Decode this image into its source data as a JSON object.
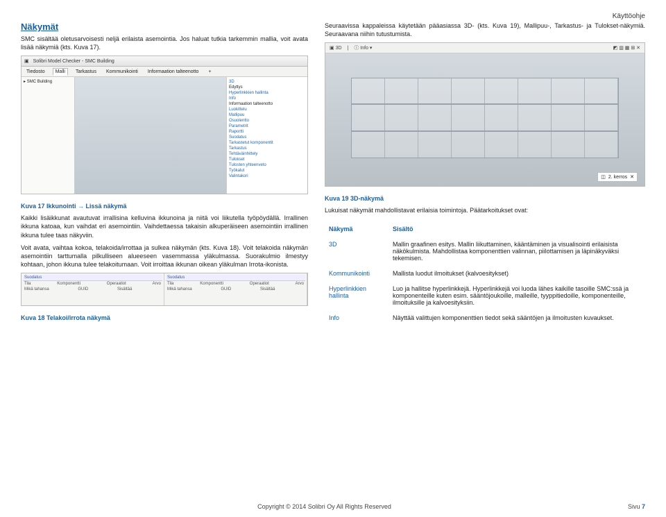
{
  "header": {
    "doc_type": "Käyttöohje"
  },
  "left": {
    "title": "Näkymät",
    "p1": "SMC sisältää oletusarvoisesti neljä erilaista asemointia. Jos haluat tutkia tarkemmin mallia, voit avata lisää näkymiä (kts. Kuva 17).",
    "fig17": {
      "title": "Solibri Model Checker - SMC Building",
      "tabs": [
        "Tiedosto",
        "Malli",
        "Tarkastus",
        "Kommunikointi",
        "Informaation talteenotto",
        "+"
      ],
      "tree_root": "SMC Building",
      "side_items": [
        "3D",
        "Edyttys",
        "Hyperlinkkien hallinta",
        "Info",
        "Informaation talteenotto",
        "Luokittelu",
        "Mallipuu",
        "Osuolentto",
        "Parametrit",
        "Raportti",
        "Suodatus",
        "Tarkastetut komponentit",
        "Tarkastus",
        "Tehtäväinhittely",
        "Tulokset",
        "Tulosten yhteenveto",
        "Työkalut",
        "Valintakori"
      ]
    },
    "cap17": "Kuva 17 Ikkunointi → Lissä näkymä",
    "p2": "Kaikki lisäikkunat avautuvat irrallisina kelluvina ikkunoina ja niitä voi liikutella työpöydällä. Irrallinen ikkuna katoaa, kun vaihdat eri asemointiin. Vaihdettaessa takaisin alkuperäiseen asemointiin irrallinen ikkuna tulee taas näkyviin.",
    "p3": "Voit avata, vaihtaa kokoa, telakoida/irrottaa ja sulkea näkymän (kts. Kuva 18). Voit telakoida näkymän asemointiin tarttumalla pilkulliseen alueeseen vasemmassa yläkulmassa. Suorakulmio ilmestyy kohtaan, johon ikkuna tulee telakoitumaan. Voit irroittaa ikkunan oikean yläkulman Irrota-ikonista.",
    "fig18": {
      "left_title": "Suodatus",
      "left_cols": [
        "Tila",
        "Komponentti",
        "Operaatiot",
        "Arvo"
      ],
      "left_row": [
        "Mikä tahansa",
        "GUID",
        "Sisältää",
        ""
      ],
      "right_title": "Suodatus",
      "right_cols": [
        "Tila",
        "Komponentti",
        "Operaatiot",
        "Arvo"
      ],
      "right_row": [
        "Mikä tahansa",
        "GUID",
        "Sisältää",
        ""
      ]
    },
    "cap18": "Kuva 18 Telakoi/irrota näkymä"
  },
  "right": {
    "p1": "Seuraavissa kappaleissa käytetään pääasiassa 3D- (kts. Kuva 19), Mallipuu-, Tarkastus- ja Tulokset-näkymiä. Seuraavana niihin tutustumista.",
    "fig19": {
      "toolbar": [
        "3D",
        "Info"
      ],
      "tag": "2. kerros"
    },
    "cap19": "Kuva 19 3D-näkymä",
    "p2": "Lukuisat näkymät mahdollistavat erilaisia toimintoja. Päätarkoitukset ovat:",
    "table": {
      "head": [
        "Näkymä",
        "Sisältö"
      ],
      "rows": [
        {
          "k": "3D",
          "v": "Mallin graafinen esitys. Mallin liikuttaminen, kääntäminen ja visualisointi erilaisista näkökulmista. Mahdollistaa komponenttien valinnan, piilottamisen ja läpinäkyväksi tekemisen."
        },
        {
          "k": "Kommunikointi",
          "v": "Mallista luodut ilmoitukset (kalvoesitykset)"
        },
        {
          "k": "Hyperlinkkien hallinta",
          "v": "Luo ja hallitse hyperlinkkejä. Hyperlinkkejä voi luoda lähes kaikille tasoille SMC:ssä ja komponenteille kuten esim. sääntöjoukoille, malleille, tyyppitiedoille, komponenteille, ilmoituksille ja kalvoesityksiin."
        },
        {
          "k": "Info",
          "v": "Näyttää valittujen komponenttien tiedot sekä sääntöjen ja ilmoitusten kuvaukset."
        }
      ]
    }
  },
  "footer": {
    "copyright": "Copyright © 2014 Solibri Oy All Rights Reserved",
    "page_label": "Sivu",
    "page_num": "7"
  }
}
